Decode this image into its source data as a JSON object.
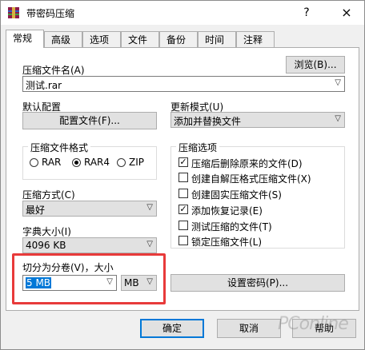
{
  "window": {
    "title": "带密码压缩",
    "help_symbol": "?",
    "close_symbol": "×",
    "icon": "winrar-archive-icon"
  },
  "tabs": [
    {
      "label": "常规",
      "active": true
    },
    {
      "label": "高级"
    },
    {
      "label": "选项"
    },
    {
      "label": "文件"
    },
    {
      "label": "备份"
    },
    {
      "label": "时间"
    },
    {
      "label": "注释"
    }
  ],
  "archive_name": {
    "label": "压缩文件名(A)",
    "value": "测试.rar",
    "browse_label": "浏览(B)..."
  },
  "profile": {
    "label": "默认配置",
    "button_label": "配置文件(F)..."
  },
  "update_mode": {
    "label": "更新模式(U)",
    "value": "添加并替换文件"
  },
  "format": {
    "label": "压缩文件格式",
    "options": [
      {
        "label": "RAR",
        "selected": false
      },
      {
        "label": "RAR4",
        "selected": true
      },
      {
        "label": "ZIP",
        "selected": false
      }
    ]
  },
  "method": {
    "label": "压缩方式(C)",
    "value": "最好"
  },
  "dictionary": {
    "label": "字典大小(I)",
    "value": "4096 KB"
  },
  "split": {
    "label": "切分为分卷(V)，大小",
    "value": "5 MB",
    "unit": "MB"
  },
  "options": {
    "label": "压缩选项",
    "items": [
      {
        "label": "压缩后删除原来的文件(D)",
        "checked": true
      },
      {
        "label": "创建自解压格式压缩文件(X)",
        "checked": false
      },
      {
        "label": "创建固实压缩文件(S)",
        "checked": false
      },
      {
        "label": "添加恢复记录(E)",
        "checked": true
      },
      {
        "label": "测试压缩的文件(T)",
        "checked": false
      },
      {
        "label": "锁定压缩文件(L)",
        "checked": false
      }
    ]
  },
  "password_button": "设置密码(P)...",
  "footer": {
    "ok": "确定",
    "cancel": "取消",
    "help": "帮助"
  },
  "watermark": "PConline",
  "colors": {
    "accent": "#0078d7",
    "highlight_border": "#e83a3a"
  }
}
